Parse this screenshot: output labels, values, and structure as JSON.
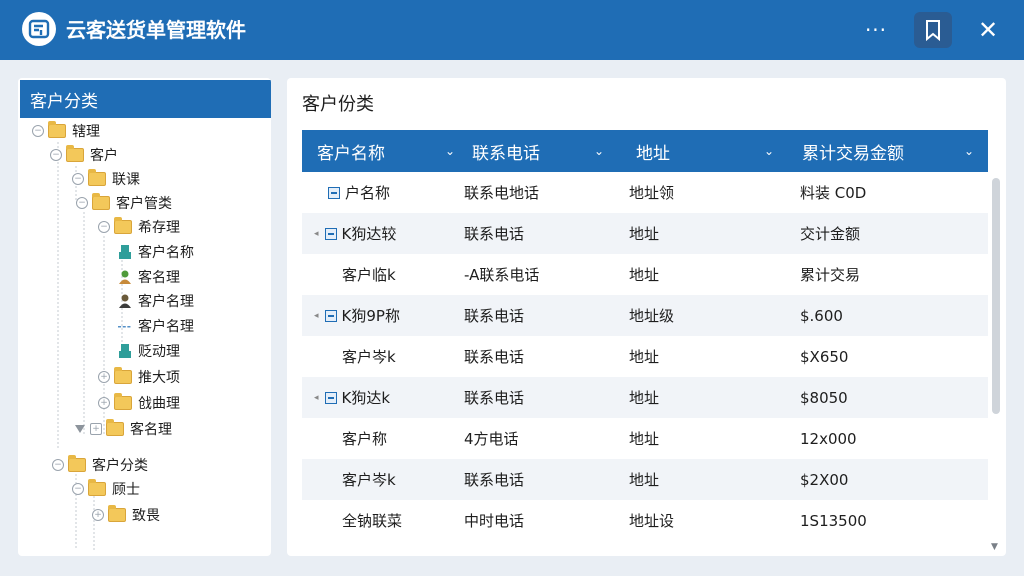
{
  "app": {
    "title": "云客送货单管理软件",
    "logo_icon": "app-logo-icon"
  },
  "titlebar": {
    "more_icon": "more-icon",
    "more_glyph": "···",
    "bookmark_icon": "bookmark-icon",
    "close_icon": "close-icon",
    "close_glyph": "✕"
  },
  "left": {
    "header": "客户分类",
    "tree": [
      {
        "label": "辖理",
        "icon": "folder-icon"
      },
      {
        "label": "客户",
        "icon": "folder-icon"
      },
      {
        "label": "联课",
        "icon": "folder-icon"
      },
      {
        "label": "客户管类",
        "icon": "folder-icon"
      },
      {
        "label": "希存理",
        "icon": "folder-icon"
      },
      {
        "label": "客户名称",
        "icon": "user-teal-icon"
      },
      {
        "label": "客名理",
        "icon": "user-green-icon"
      },
      {
        "label": "客户名理",
        "icon": "user-dark-icon"
      },
      {
        "label": "客户名理",
        "icon": "dash-icon"
      },
      {
        "label": "贬动理",
        "icon": "user-teal-icon"
      },
      {
        "label": "推大项",
        "icon": "folder-icon"
      },
      {
        "label": "戗曲理",
        "icon": "folder-icon"
      },
      {
        "label": "客名理",
        "icon": "folder-icon"
      },
      {
        "label": "客户分类",
        "icon": "folder-icon"
      },
      {
        "label": "顾士",
        "icon": "folder-icon"
      },
      {
        "label": "致畏",
        "icon": "folder-icon"
      }
    ]
  },
  "right": {
    "title": "客户份类",
    "columns": [
      "客户名称",
      "联系电话",
      "地址",
      "累计交易金额"
    ],
    "rows": [
      {
        "name": "户名称",
        "phone": "联系电地话",
        "addr": "地址领",
        "amount": "料装 C0D",
        "icon": true,
        "expander": false
      },
      {
        "name": "K狗达较",
        "phone": "联系电话",
        "addr": "地址",
        "amount": "交计金额",
        "icon": true,
        "expander": true
      },
      {
        "name": "客户临k",
        "phone": "-A联系电话",
        "addr": "地址",
        "amount": "累计交易",
        "icon": false,
        "expander": false
      },
      {
        "name": "K狗9P称",
        "phone": "联系电话",
        "addr": "地址级",
        "amount": "$.600",
        "icon": true,
        "expander": true
      },
      {
        "name": "客户岑k",
        "phone": "联系电话",
        "addr": "地址",
        "amount": "$X650",
        "icon": false,
        "expander": false
      },
      {
        "name": "K狗达k",
        "phone": "联系电话",
        "addr": "地址",
        "amount": "$8050",
        "icon": true,
        "expander": true
      },
      {
        "name": "客户称",
        "phone": "4方电话",
        "addr": "地址",
        "amount": "12x000",
        "icon": false,
        "expander": false
      },
      {
        "name": "客户岑k",
        "phone": "联系电话",
        "addr": "地址",
        "amount": "$2X00",
        "icon": false,
        "expander": false
      },
      {
        "name": "全钠联菜",
        "phone": "中时电话",
        "addr": "地址设",
        "amount": "1S13500",
        "icon": false,
        "expander": false
      }
    ]
  }
}
